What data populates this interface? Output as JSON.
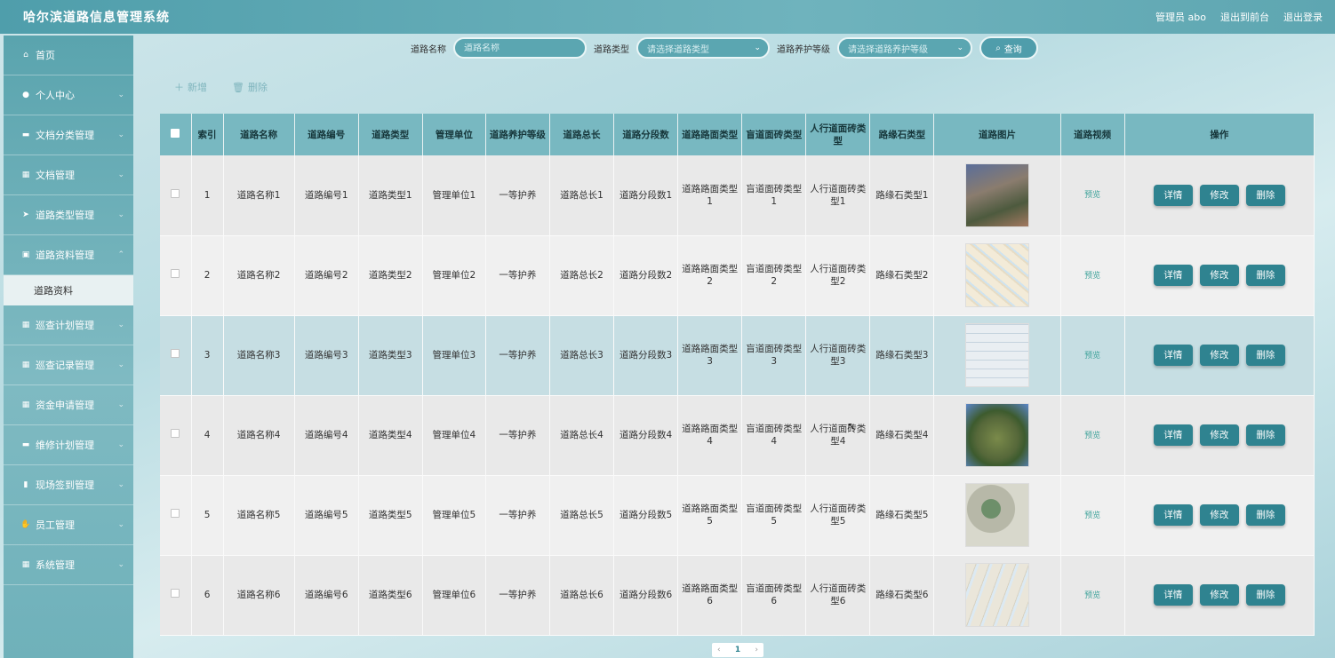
{
  "header": {
    "title": "哈尔滨道路信息管理系统",
    "user_label": "管理员 abo",
    "front_link": "退出到前台",
    "logout_link": "退出登录"
  },
  "sidebar": {
    "items": [
      {
        "label": "首页",
        "icon": "home-icon",
        "glyph": "⌂"
      },
      {
        "label": "个人中心",
        "icon": "user-icon",
        "glyph": "●"
      },
      {
        "label": "文档分类管理",
        "icon": "category-icon",
        "glyph": "▬"
      },
      {
        "label": "文档管理",
        "icon": "grid-icon",
        "glyph": "▦"
      },
      {
        "label": "道路类型管理",
        "icon": "send-icon",
        "glyph": "➤"
      },
      {
        "label": "道路资料管理",
        "icon": "clipboard-icon",
        "glyph": "▣"
      },
      {
        "label": "巡查计划管理",
        "icon": "grid-icon",
        "glyph": "▦"
      },
      {
        "label": "巡查记录管理",
        "icon": "grid-icon",
        "glyph": "▦"
      },
      {
        "label": "资金申请管理",
        "icon": "grid-icon",
        "glyph": "▦"
      },
      {
        "label": "维修计划管理",
        "icon": "comment-icon",
        "glyph": "▬"
      },
      {
        "label": "现场签到管理",
        "icon": "bar-chart-icon",
        "glyph": "▮"
      },
      {
        "label": "员工管理",
        "icon": "thumbs-up-icon",
        "glyph": "✋"
      },
      {
        "label": "系统管理",
        "icon": "grid-icon",
        "glyph": "▦"
      }
    ],
    "sub_active": "道路资料"
  },
  "search": {
    "name_label": "道路名称",
    "name_placeholder": "道路名称",
    "type_label": "道路类型",
    "type_placeholder": "请选择道路类型",
    "level_label": "道路养护等级",
    "level_placeholder": "请选择道路养护等级",
    "query_label": "查询"
  },
  "toolbar": {
    "add_label": "新增",
    "delete_label": "删除"
  },
  "table": {
    "columns": [
      "索引",
      "道路名称",
      "道路编号",
      "道路类型",
      "管理单位",
      "道路养护等级",
      "道路总长",
      "道路分段数",
      "道路路面类型",
      "盲道面砖类型",
      "人行道面砖类型",
      "路缘石类型",
      "道路图片",
      "道路视频",
      "操作"
    ],
    "preview_label": "预览",
    "detail_label": "详情",
    "edit_label": "修改",
    "delete_label": "删除",
    "rows": [
      {
        "idx": "1",
        "name": "道路名称1",
        "code": "道路编号1",
        "type": "道路类型1",
        "unit": "管理单位1",
        "level": "一等护养",
        "length": "道路总长1",
        "segments": "道路分段数1",
        "surface": "道路路面类型1",
        "blind": "盲道面砖类型1",
        "sidewalk": "人行道面砖类型1",
        "curb": "路缘石类型1"
      },
      {
        "idx": "2",
        "name": "道路名称2",
        "code": "道路编号2",
        "type": "道路类型2",
        "unit": "管理单位2",
        "level": "一等护养",
        "length": "道路总长2",
        "segments": "道路分段数2",
        "surface": "道路路面类型2",
        "blind": "盲道面砖类型2",
        "sidewalk": "人行道面砖类型2",
        "curb": "路缘石类型2"
      },
      {
        "idx": "3",
        "name": "道路名称3",
        "code": "道路编号3",
        "type": "道路类型3",
        "unit": "管理单位3",
        "level": "一等护养",
        "length": "道路总长3",
        "segments": "道路分段数3",
        "surface": "道路路面类型3",
        "blind": "盲道面砖类型3",
        "sidewalk": "人行道面砖类型3",
        "curb": "路缘石类型3"
      },
      {
        "idx": "4",
        "name": "道路名称4",
        "code": "道路编号4",
        "type": "道路类型4",
        "unit": "管理单位4",
        "level": "一等护养",
        "length": "道路总长4",
        "segments": "道路分段数4",
        "surface": "道路路面类型4",
        "blind": "盲道面砖类型4",
        "sidewalk": "人行道面砖类型4",
        "curb": "路缘石类型4"
      },
      {
        "idx": "5",
        "name": "道路名称5",
        "code": "道路编号5",
        "type": "道路类型5",
        "unit": "管理单位5",
        "level": "一等护养",
        "length": "道路总长5",
        "segments": "道路分段数5",
        "surface": "道路路面类型5",
        "blind": "盲道面砖类型5",
        "sidewalk": "人行道面砖类型5",
        "curb": "路缘石类型5"
      },
      {
        "idx": "6",
        "name": "道路名称6",
        "code": "道路编号6",
        "type": "道路类型6",
        "unit": "管理单位6",
        "level": "一等护养",
        "length": "道路总长6",
        "segments": "道路分段数6",
        "surface": "道路路面类型6",
        "blind": "盲道面砖类型6",
        "sidewalk": "人行道面砖类型6",
        "curb": "路缘石类型6"
      }
    ]
  },
  "pager": {
    "prev": "‹",
    "current": "1",
    "next": "›"
  }
}
